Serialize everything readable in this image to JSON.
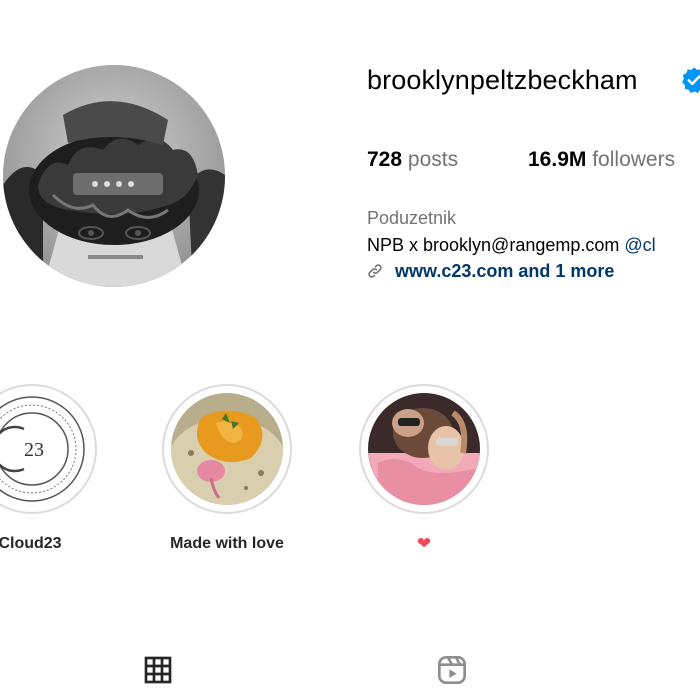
{
  "profile": {
    "username": "brooklynpeltzbeckham",
    "verified_icon": "verified-badge-icon",
    "accent_color": "#0095f6"
  },
  "stats": {
    "posts_count": "728",
    "posts_label": "posts",
    "followers_count": "16.9M",
    "followers_label": "followers"
  },
  "bio": {
    "category": "Poduzetnik",
    "text": "NPB x brooklyn@rangemp.com ",
    "mention": "@cl",
    "link_text": "www.c23.com and 1 more",
    "link_icon": "link-icon"
  },
  "highlights": [
    {
      "label": "Cloud23",
      "cover_text": "23"
    },
    {
      "label": "Made with love"
    },
    {
      "label": "❤"
    }
  ],
  "tabs": [
    {
      "icon": "grid-icon"
    },
    {
      "icon": "reels-icon"
    }
  ],
  "colors": {
    "link_color": "#00376b",
    "secondary_text": "#737373",
    "heart": "#ed4956"
  }
}
